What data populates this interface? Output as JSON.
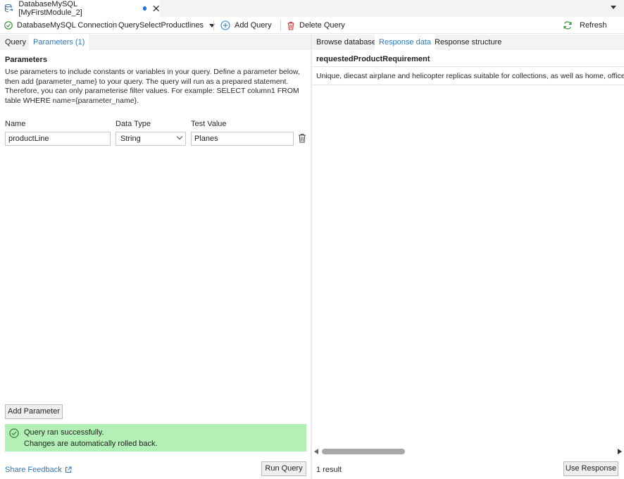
{
  "tab": {
    "title": "DatabaseMySQL [MyFirstModule_2]",
    "icon": "database-icon",
    "modified_indicator_color": "#1a73e8"
  },
  "toolbar": {
    "connection_label": "DatabaseMySQL Connection",
    "query_select_label": "QuerySelectProductlines",
    "add_query_label": "Add Query",
    "delete_query_label": "Delete Query",
    "refresh_label": "Refresh"
  },
  "left_tabs": [
    {
      "label": "Query",
      "active": false
    },
    {
      "label": "Parameters (1)",
      "active": true
    }
  ],
  "right_tabs": [
    {
      "label": "Browse database",
      "active": false
    },
    {
      "label": "Response data",
      "active": true
    },
    {
      "label": "Response structure",
      "active": false
    }
  ],
  "parameters": {
    "title": "Parameters",
    "description": "Use parameters to include constants or variables in your query. Define a parameter below, then add {parameter_name} to your query. The query will run as a prepared statement. Therefore, you can only parameterise filter values. For example: SELECT column1 FROM table WHERE name={parameter_name}.",
    "columns": {
      "name": "Name",
      "data_type": "Data Type",
      "test_value": "Test Value"
    },
    "rows": [
      {
        "name": "productLine",
        "data_type": "String",
        "test_value": "Planes"
      }
    ],
    "add_button": "Add Parameter"
  },
  "status": {
    "line1": "Query ran successfully.",
    "line2": "Changes are automatically rolled back.",
    "color": "#b3f0b5"
  },
  "footer": {
    "share_feedback": "Share Feedback",
    "run_query": "Run Query",
    "result_count": "1 result",
    "use_response": "Use Response"
  },
  "response": {
    "column": "requestedProductRequirement",
    "rows": [
      "Unique, diecast airplane and helicopter replicas suitable for collections, as well as home, office or"
    ]
  },
  "colors": {
    "accent": "#2b79c2",
    "tab_bar": "#f3f3f3"
  }
}
